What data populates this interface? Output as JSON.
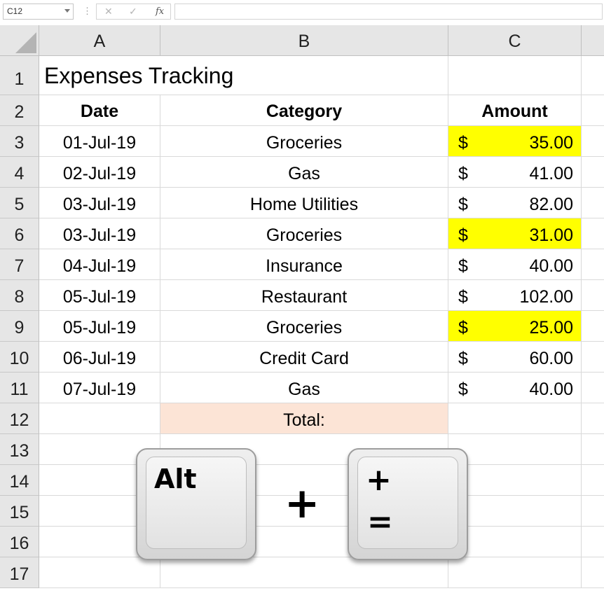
{
  "formula_bar": {
    "name_box": "C12",
    "cancel_symbol": "✕",
    "enter_symbol": "✓",
    "fx_symbol": "fx",
    "formula": ""
  },
  "columns": [
    "A",
    "B",
    "C"
  ],
  "rows": [
    "1",
    "2",
    "3",
    "4",
    "5",
    "6",
    "7",
    "8",
    "9",
    "10",
    "11",
    "12",
    "13",
    "14",
    "15",
    "16",
    "17"
  ],
  "sheet": {
    "title": "Expenses Tracking",
    "headers": {
      "date": "Date",
      "category": "Category",
      "amount": "Amount"
    },
    "currency_symbol": "$",
    "entries": [
      {
        "date": "01-Jul-19",
        "category": "Groceries",
        "amount": "35.00",
        "highlight": true
      },
      {
        "date": "02-Jul-19",
        "category": "Gas",
        "amount": "41.00",
        "highlight": false
      },
      {
        "date": "03-Jul-19",
        "category": "Home Utilities",
        "amount": "82.00",
        "highlight": false
      },
      {
        "date": "03-Jul-19",
        "category": "Groceries",
        "amount": "31.00",
        "highlight": true
      },
      {
        "date": "04-Jul-19",
        "category": "Insurance",
        "amount": "40.00",
        "highlight": false
      },
      {
        "date": "05-Jul-19",
        "category": "Restaurant",
        "amount": "102.00",
        "highlight": false
      },
      {
        "date": "05-Jul-19",
        "category": "Groceries",
        "amount": "25.00",
        "highlight": true
      },
      {
        "date": "06-Jul-19",
        "category": "Credit Card",
        "amount": "60.00",
        "highlight": false
      },
      {
        "date": "07-Jul-19",
        "category": "Gas",
        "amount": "40.00",
        "highlight": false
      }
    ],
    "total_label": "Total:"
  },
  "shortcut": {
    "key1": "Alt",
    "joiner": "+",
    "key2_top": "+",
    "key2_bottom": "="
  },
  "colors": {
    "highlight": "#ffff00",
    "total_fill": "#fce4d6",
    "header_bg": "#e6e6e6"
  }
}
